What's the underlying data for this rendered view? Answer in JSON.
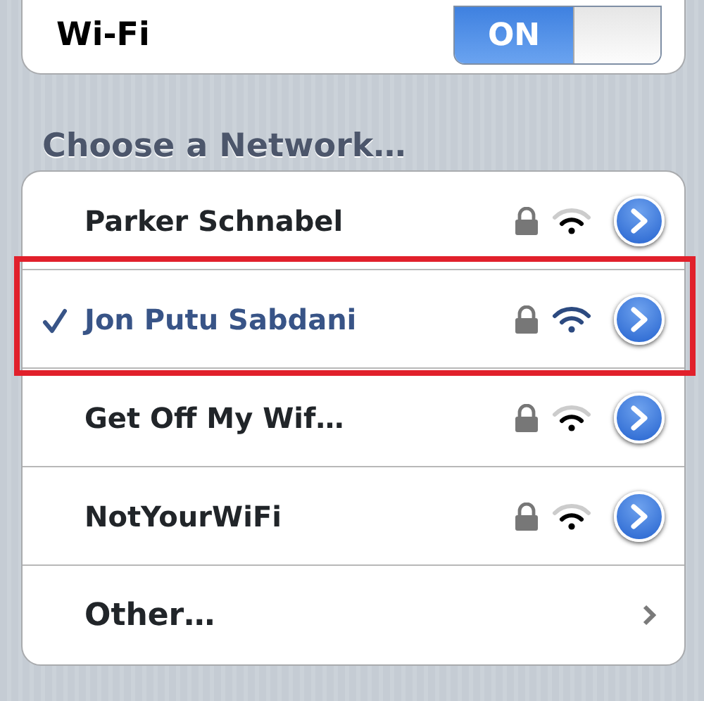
{
  "wifi": {
    "label": "Wi-Fi",
    "toggle_label": "ON",
    "on": true
  },
  "section_title": "Choose a Network…",
  "networks": [
    {
      "kind": "network",
      "name": "Parker Schnabel",
      "selected": false,
      "locked": true,
      "highlighted": false
    },
    {
      "kind": "network",
      "name": "Jon Putu Sabdani",
      "selected": true,
      "locked": true,
      "highlighted": true
    },
    {
      "kind": "network",
      "name": "Get Off My Wif…",
      "selected": false,
      "locked": true,
      "highlighted": false
    },
    {
      "kind": "network",
      "name": "NotYourWiFi",
      "selected": false,
      "locked": true,
      "highlighted": false
    },
    {
      "kind": "other",
      "name": "Other…"
    }
  ]
}
